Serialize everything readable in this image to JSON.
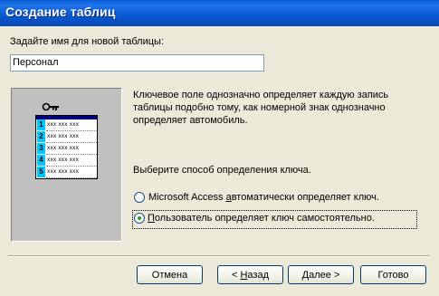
{
  "window": {
    "title": "Создание таблиц"
  },
  "form": {
    "name_label": "Задайте имя для новой таблицы:",
    "name_value": "Персонал"
  },
  "illustration": {
    "rows": [
      {
        "num": "1",
        "cells": "xxx xxx xxx"
      },
      {
        "num": "2",
        "cells": "xxx xxx xxx"
      },
      {
        "num": "3",
        "cells": "xxx xxx xxx"
      },
      {
        "num": "4",
        "cells": "xxx xxx xxx"
      },
      {
        "num": "5",
        "cells": "xxx xxx xxx"
      }
    ]
  },
  "description": {
    "line1": "Ключевое поле однозначно определяет каждую запись",
    "line2": "таблицы подобно тому, как номерной знак однозначно",
    "line3": "определяет автомобиль."
  },
  "key_section": {
    "prompt": "Выберите способ определения ключа.",
    "options": [
      {
        "label_pre": "Microsoft Access ",
        "label_ul": "а",
        "label_post": "втоматически определяет ключ.",
        "selected": false
      },
      {
        "label_pre": "",
        "label_ul": "П",
        "label_post": "ользователь определяет ключ самостоятельно.",
        "selected": true
      }
    ]
  },
  "buttons": {
    "cancel": "Отмена",
    "back_pre": "< ",
    "back_ul": "Н",
    "back_post": "азад",
    "next_pre": "",
    "next_ul": "Д",
    "next_post": "алее >",
    "finish": "Готово"
  },
  "colors": {
    "title_bar": "#0a5fd8",
    "dialog_bg": "#ece9d8",
    "radio_dot": "#21a121",
    "mini_num": "#00c8ff"
  }
}
